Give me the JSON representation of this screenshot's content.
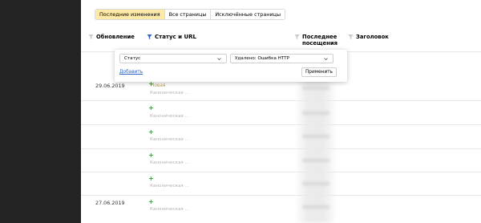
{
  "tabs": [
    {
      "label": "Последние изменения",
      "active": true
    },
    {
      "label": "Все страницы",
      "active": false
    },
    {
      "label": "Исключённые страницы",
      "active": false
    }
  ],
  "columns": {
    "updated": "Обновление",
    "status_url": "Статус и URL",
    "last_visit_line1": "Последнее",
    "last_visit_line2": "посещения",
    "title": "Заголовок"
  },
  "filter_popup": {
    "field_select": "Статус",
    "value_select": "Удалено: Ошибка HTTP",
    "add_link": "Добавить",
    "apply_button": "Применить"
  },
  "rows": [
    {
      "date": "29.06.2019",
      "status": "Новая",
      "canonical": "Каноническая …"
    },
    {
      "date": "",
      "status": "",
      "canonical": "Каноническая …"
    },
    {
      "date": "",
      "status": "",
      "canonical": "Каноническая …"
    },
    {
      "date": "",
      "status": "",
      "canonical": "Каноническая …"
    },
    {
      "date": "",
      "status": "",
      "canonical": "Каноническая …"
    },
    {
      "date": "27.06.2019",
      "status": "",
      "canonical": "Каноническая …"
    }
  ],
  "colors": {
    "sidebar": "#232323",
    "active_tab": "#fdeaa8",
    "filter_active": "#2b63c5",
    "plus": "#3a9a3a",
    "link": "#2b63c5"
  },
  "icons": {
    "filter": "funnel-icon",
    "chevron": "chevron-down-icon",
    "plus": "plus-icon"
  }
}
